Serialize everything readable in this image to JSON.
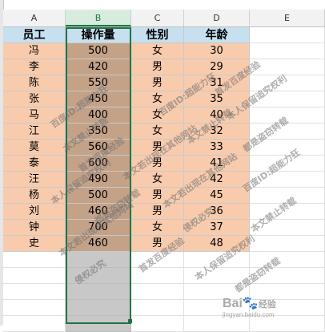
{
  "columns": [
    "A",
    "B",
    "C",
    "D",
    "E"
  ],
  "selected_column": "B",
  "headers": [
    "员工",
    "操作量",
    "性别",
    "年龄"
  ],
  "rows": [
    [
      "冯",
      "500",
      "女",
      "30"
    ],
    [
      "李",
      "420",
      "男",
      "29"
    ],
    [
      "陈",
      "550",
      "男",
      "31"
    ],
    [
      "张",
      "450",
      "女",
      "35"
    ],
    [
      "马",
      "400",
      "女",
      "40"
    ],
    [
      "江",
      "350",
      "女",
      "32"
    ],
    [
      "莫",
      "560",
      "男",
      "33"
    ],
    [
      "泰",
      "600",
      "男",
      "41"
    ],
    [
      "汪",
      "490",
      "女",
      "42"
    ],
    [
      "杨",
      "500",
      "男",
      "45"
    ],
    [
      "刘",
      "460",
      "男",
      "36"
    ],
    [
      "钟",
      "700",
      "女",
      "37"
    ],
    [
      "史",
      "460",
      "男",
      "48"
    ]
  ],
  "watermarks": [
    "百度ID:超能力狂",
    "本文禁止转载",
    "首发百度经验",
    "本人保留追究权利",
    "都是盗窃转载",
    "本文若出现在其他网站",
    "侵权必究"
  ],
  "brand": {
    "logo_text": "Bai",
    "logo_suffix": "经验",
    "sub": "jingyan.baidu.com"
  },
  "colors": {
    "header_fill": "#c6e0f0",
    "data_fill": "#f8cbad",
    "selection_fill": "#c3a288",
    "selection_border": "#217346"
  }
}
